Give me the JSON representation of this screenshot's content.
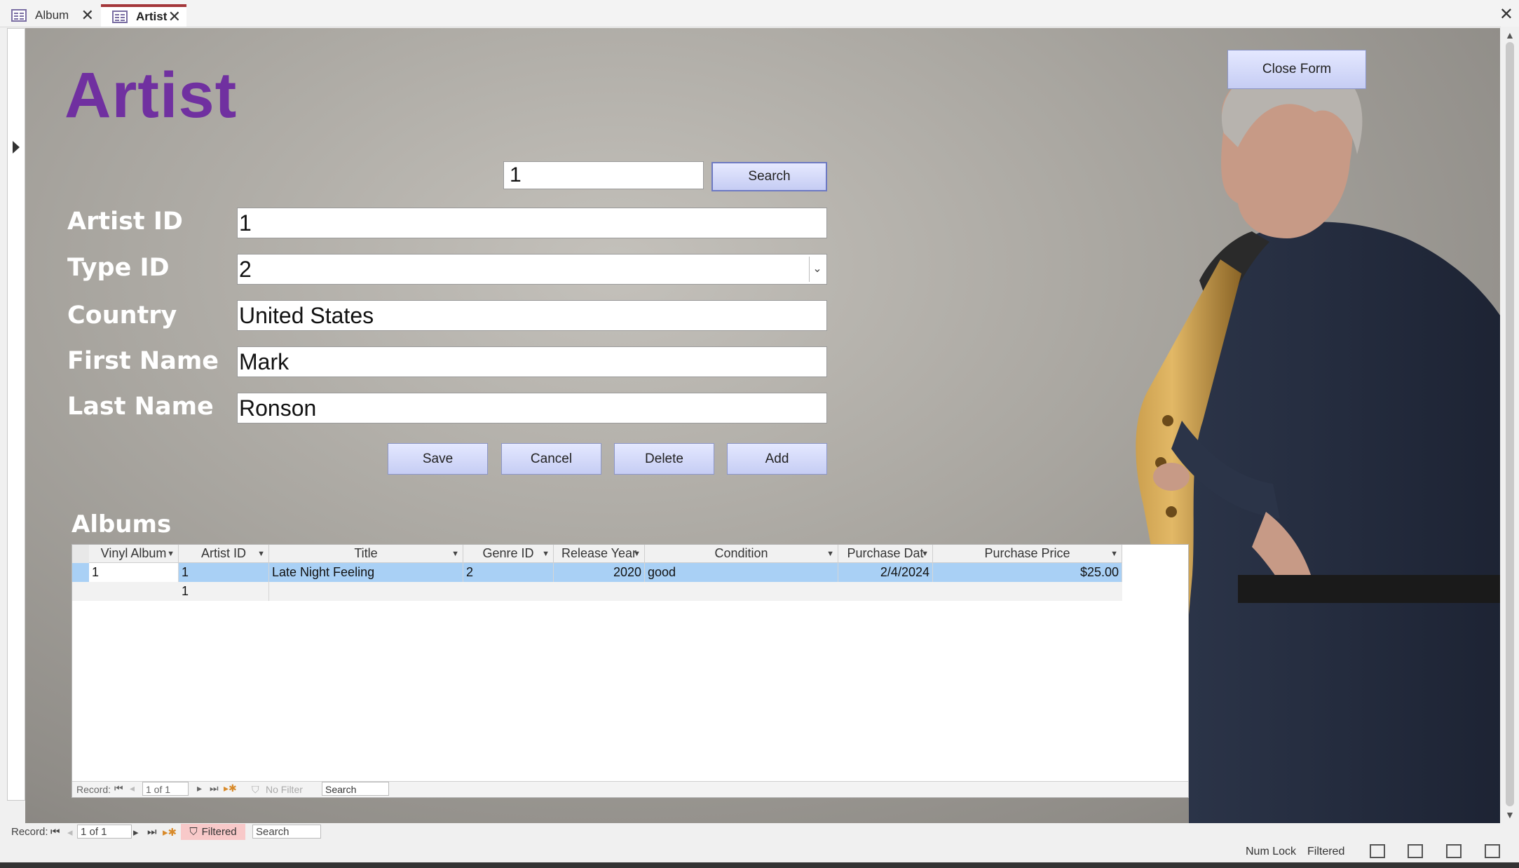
{
  "tabs": [
    {
      "label": "Album",
      "active": false
    },
    {
      "label": "Artist",
      "active": true
    }
  ],
  "form": {
    "title": "Artist",
    "close_label": "Close Form",
    "search_value": "1",
    "search_label": "Search",
    "fields": [
      {
        "label": "Artist ID",
        "value": "1"
      },
      {
        "label": "Type ID",
        "value": "2",
        "type": "combo"
      },
      {
        "label": "Country",
        "value": "United States"
      },
      {
        "label": "First Name",
        "value": "Mark"
      },
      {
        "label": "Last Name",
        "value": "Ronson"
      }
    ],
    "buttons": {
      "save": "Save",
      "cancel": "Cancel",
      "delete": "Delete",
      "add": "Add"
    }
  },
  "albums": {
    "title": "Albums",
    "columns": [
      "Vinyl Album",
      "Artist ID",
      "Title",
      "Genre ID",
      "Release Year",
      "Condition",
      "Purchase Dat",
      "Purchase Price"
    ],
    "rows": [
      [
        "1",
        "1",
        "Late Night Feeling",
        "2",
        "2020",
        "good",
        "2/4/2024",
        "$25.00"
      ]
    ],
    "new_row_artist_id": "1",
    "nav": {
      "record_label": "Record:",
      "position": "1 of 1",
      "filter": "No Filter",
      "search": "Search"
    }
  },
  "main_nav": {
    "record_label": "Record:",
    "position": "1 of 1",
    "filter": "Filtered",
    "search": "Search"
  },
  "status": {
    "num_lock": "Num Lock",
    "filtered": "Filtered"
  },
  "colors": {
    "title": "#7030a0",
    "button": "#c6cdf4",
    "selected_row": "#a9d0f5",
    "filtered": "#f8c9c9"
  }
}
